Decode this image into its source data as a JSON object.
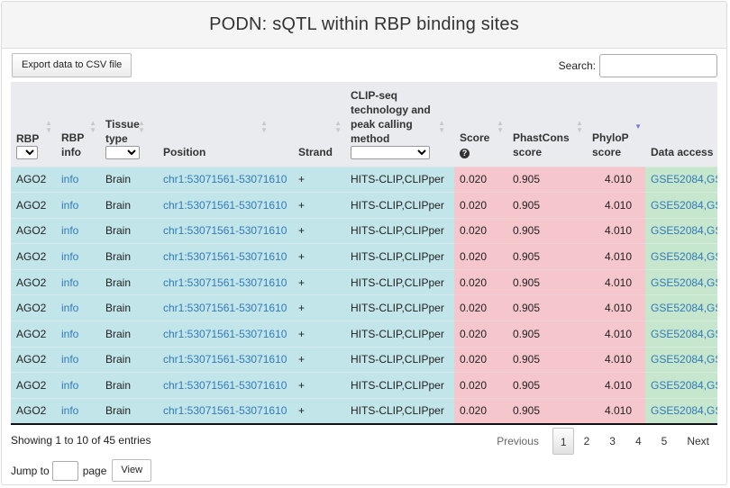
{
  "header": {
    "title": "PODN: sQTL within RBP binding sites"
  },
  "toolbar": {
    "export_label": "Export data to CSV file",
    "search_label": "Search:",
    "search_value": ""
  },
  "table": {
    "columns": [
      {
        "label": "RBP",
        "filter": true,
        "sortable": true
      },
      {
        "label": "RBP info",
        "sortable": true
      },
      {
        "label": "Tissue type",
        "filter": true,
        "sortable": true
      },
      {
        "label": "Position",
        "sortable": true
      },
      {
        "label": "Strand",
        "sortable": true
      },
      {
        "label": "CLIP-seq technology and peak calling method",
        "filter": true,
        "sortable": true
      },
      {
        "label": "Score",
        "help_icon": "question-circle-icon",
        "sortable": true
      },
      {
        "label": "PhastCons score",
        "sortable": true
      },
      {
        "label": "PhyloP score",
        "sortable": true,
        "sorted": "descending"
      },
      {
        "label": "Data access"
      }
    ],
    "rows": [
      {
        "rbp": "AGO2",
        "info": "info",
        "tissue": "Brain",
        "position": "chr1:53071561-53071610",
        "strand": "+",
        "method": "HITS-CLIP,CLIPper",
        "score": "0.020",
        "phastcons": "0.905",
        "phylop": "4.010",
        "access": "GSE52084,GS"
      },
      {
        "rbp": "AGO2",
        "info": "info",
        "tissue": "Brain",
        "position": "chr1:53071561-53071610",
        "strand": "+",
        "method": "HITS-CLIP,CLIPper",
        "score": "0.020",
        "phastcons": "0.905",
        "phylop": "4.010",
        "access": "GSE52084,GS"
      },
      {
        "rbp": "AGO2",
        "info": "info",
        "tissue": "Brain",
        "position": "chr1:53071561-53071610",
        "strand": "+",
        "method": "HITS-CLIP,CLIPper",
        "score": "0.020",
        "phastcons": "0.905",
        "phylop": "4.010",
        "access": "GSE52084,GS"
      },
      {
        "rbp": "AGO2",
        "info": "info",
        "tissue": "Brain",
        "position": "chr1:53071561-53071610",
        "strand": "+",
        "method": "HITS-CLIP,CLIPper",
        "score": "0.020",
        "phastcons": "0.905",
        "phylop": "4.010",
        "access": "GSE52084,GS"
      },
      {
        "rbp": "AGO2",
        "info": "info",
        "tissue": "Brain",
        "position": "chr1:53071561-53071610",
        "strand": "+",
        "method": "HITS-CLIP,CLIPper",
        "score": "0.020",
        "phastcons": "0.905",
        "phylop": "4.010",
        "access": "GSE52084,GS"
      },
      {
        "rbp": "AGO2",
        "info": "info",
        "tissue": "Brain",
        "position": "chr1:53071561-53071610",
        "strand": "+",
        "method": "HITS-CLIP,CLIPper",
        "score": "0.020",
        "phastcons": "0.905",
        "phylop": "4.010",
        "access": "GSE52084,GS"
      },
      {
        "rbp": "AGO2",
        "info": "info",
        "tissue": "Brain",
        "position": "chr1:53071561-53071610",
        "strand": "+",
        "method": "HITS-CLIP,CLIPper",
        "score": "0.020",
        "phastcons": "0.905",
        "phylop": "4.010",
        "access": "GSE52084,GS"
      },
      {
        "rbp": "AGO2",
        "info": "info",
        "tissue": "Brain",
        "position": "chr1:53071561-53071610",
        "strand": "+",
        "method": "HITS-CLIP,CLIPper",
        "score": "0.020",
        "phastcons": "0.905",
        "phylop": "4.010",
        "access": "GSE52084,GS"
      },
      {
        "rbp": "AGO2",
        "info": "info",
        "tissue": "Brain",
        "position": "chr1:53071561-53071610",
        "strand": "+",
        "method": "HITS-CLIP,CLIPper",
        "score": "0.020",
        "phastcons": "0.905",
        "phylop": "4.010",
        "access": "GSE52084,GS"
      },
      {
        "rbp": "AGO2",
        "info": "info",
        "tissue": "Brain",
        "position": "chr1:53071561-53071610",
        "strand": "+",
        "method": "HITS-CLIP,CLIPper",
        "score": "0.020",
        "phastcons": "0.905",
        "phylop": "4.010",
        "access": "GSE52084,GS"
      }
    ]
  },
  "colors": {
    "annotation_bg": "#c2e5ea",
    "score_bg": "#f5c6cc",
    "access_bg": "#c6e6cd",
    "link": "#337ab7"
  },
  "footer": {
    "info": "Showing 1 to 10 of 45 entries",
    "previous": "Previous",
    "pages": [
      "1",
      "2",
      "3",
      "4",
      "5"
    ],
    "current_page": "1",
    "next": "Next",
    "jump_label": "Jump to",
    "jump_value": "",
    "page_label": "page",
    "view_label": "View"
  }
}
